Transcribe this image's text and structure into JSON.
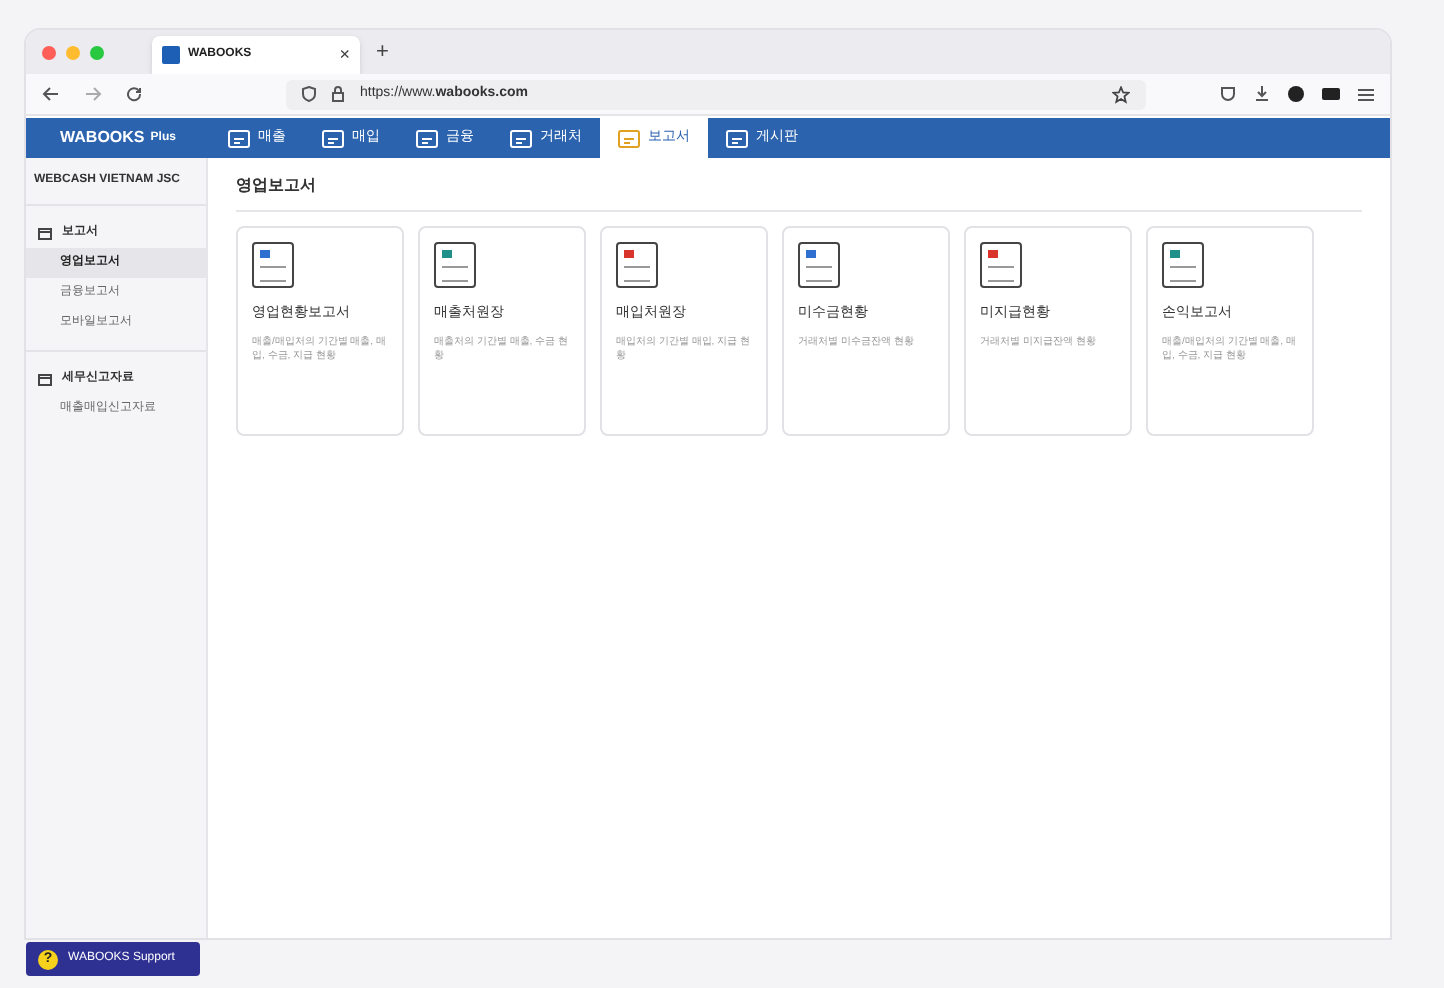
{
  "browser": {
    "tab_title": "WABOOKS",
    "new_tab": "+",
    "close": "×",
    "url_prefix": "https://www.",
    "url_domain": "wabooks.com"
  },
  "app": {
    "logo": "WABOOKS",
    "logo_suffix": "Plus"
  },
  "nav": [
    {
      "label": "매출",
      "selected": false
    },
    {
      "label": "매입",
      "selected": false
    },
    {
      "label": "금융",
      "selected": false
    },
    {
      "label": "거래처",
      "selected": false
    },
    {
      "label": "보고서",
      "selected": true
    },
    {
      "label": "게시판",
      "selected": false
    }
  ],
  "sidebar": {
    "company": "WEBCASH VIETNAM JSC",
    "groups": [
      {
        "label": "보고서",
        "children": [
          {
            "label": "영업보고서",
            "selected": true
          },
          {
            "label": "금융보고서",
            "selected": false
          },
          {
            "label": "모바일보고서",
            "selected": false
          }
        ]
      },
      {
        "label": "세무신고자료",
        "children": [
          {
            "label": "매출매입신고자료",
            "selected": false
          }
        ]
      }
    ]
  },
  "page_title": "영업보고서",
  "cards": [
    {
      "title": "영업현황보고서",
      "description": "매출/매입처의 기간별 매출, 매입, 수금, 지급 현황",
      "color": "#2f6fd0"
    },
    {
      "title": "매출처원장",
      "description": "매출처의 기간별 매출, 수금 현황",
      "color": "#1f8f8a"
    },
    {
      "title": "매입처원장",
      "description": "매입처의 기간별 매입, 지급 현황",
      "color": "#d9342b"
    },
    {
      "title": "미수금현황",
      "description": "거래처별 미수금잔액 현황",
      "color": "#2f6fd0"
    },
    {
      "title": "미지급현황",
      "description": "거래처별 미지급잔액 현황",
      "color": "#d9342b"
    },
    {
      "title": "손익보고서",
      "description": "매출/매입처의 기간별 매출, 매입, 수금, 지급 현황",
      "color": "#1f8f8a"
    }
  ],
  "support": {
    "icon": "?",
    "label": "WABOOKS Support"
  }
}
